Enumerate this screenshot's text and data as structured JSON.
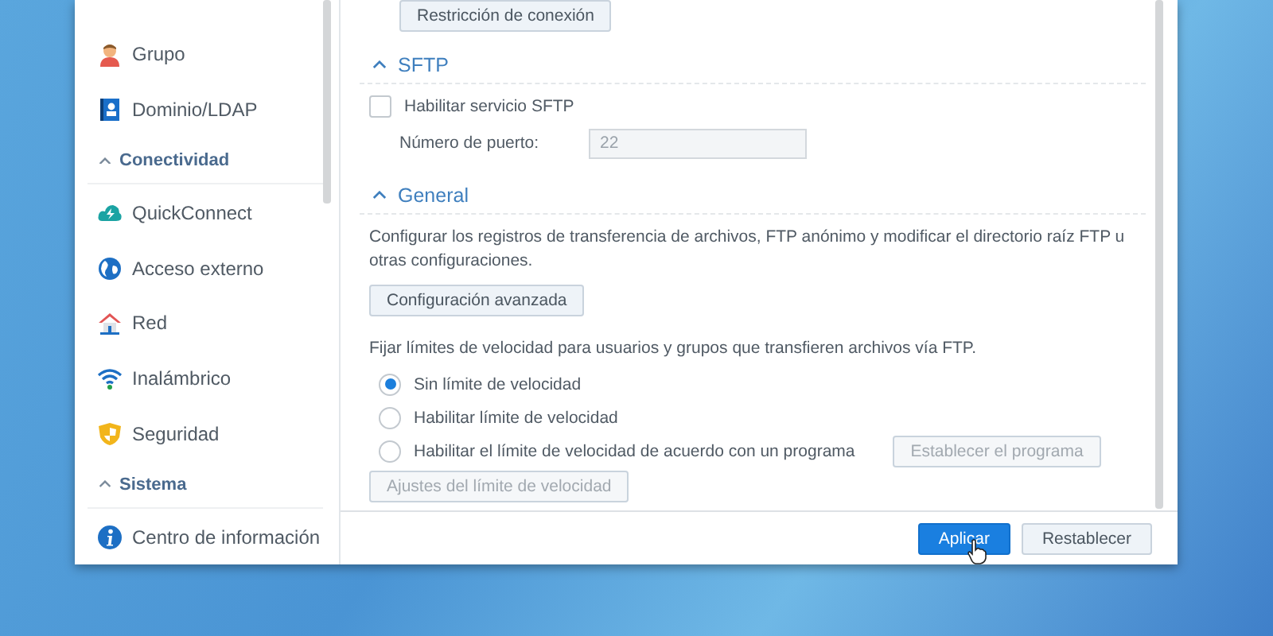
{
  "sidebar": {
    "items": [
      {
        "kind": "item",
        "label": "Grupo"
      },
      {
        "kind": "item",
        "label": "Dominio/LDAP"
      },
      {
        "kind": "header",
        "label": "Conectividad",
        "expanded": true
      },
      {
        "kind": "item",
        "label": "QuickConnect"
      },
      {
        "kind": "item",
        "label": "Acceso externo"
      },
      {
        "kind": "item",
        "label": "Red"
      },
      {
        "kind": "item",
        "label": "Inalámbrico"
      },
      {
        "kind": "item",
        "label": "Seguridad"
      },
      {
        "kind": "header",
        "label": "Sistema",
        "expanded": true
      },
      {
        "kind": "item",
        "label": "Centro de información"
      }
    ]
  },
  "connection_button": "Restricción de conexión",
  "sftp": {
    "title": "SFTP",
    "expanded": true,
    "enable": {
      "label": "Habilitar servicio SFTP",
      "checked": false
    },
    "port": {
      "label": "Número de puerto:",
      "value": "22",
      "disabled": true
    }
  },
  "general": {
    "title": "General",
    "expanded": true,
    "description": "Configurar los registros de transferencia de archivos, FTP anónimo y modificar el directorio raíz FTP u otras configuraciones.",
    "advanced_button": "Configuración avanzada",
    "speed_description": "Fijar límites de velocidad para usuarios y grupos que transfieren archivos vía FTP.",
    "speed_options": [
      {
        "label": "Sin límite de velocidad",
        "selected": true
      },
      {
        "label": "Habilitar límite de velocidad",
        "selected": false
      },
      {
        "label": "Habilitar el límite de velocidad de acuerdo con un programa",
        "selected": false
      }
    ],
    "schedule_button": {
      "label": "Establecer el programa",
      "disabled": true
    },
    "limit_settings_button": {
      "label": "Ajustes del límite de velocidad",
      "disabled": true
    }
  },
  "footer": {
    "buttons": [
      {
        "label": "Aplicar",
        "kind": "primary"
      },
      {
        "label": "Restablecer",
        "kind": "secondary"
      }
    ]
  }
}
